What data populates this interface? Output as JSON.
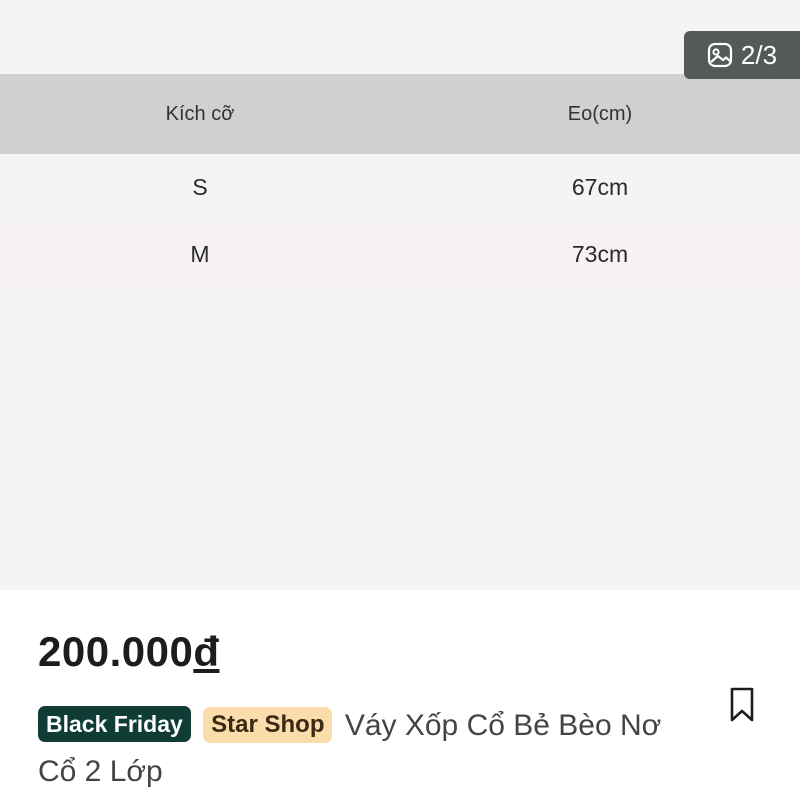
{
  "image_viewer": {
    "counter": "2/3",
    "counter_icon": "image-gallery-icon",
    "size_table": {
      "headers": [
        "Kích cỡ",
        "Eo(cm)"
      ],
      "rows": [
        [
          "S",
          "67cm"
        ],
        [
          "M",
          "73cm"
        ]
      ]
    }
  },
  "product": {
    "price": "200.000",
    "currency": "đ",
    "badges": {
      "campaign": "Black Friday",
      "shop": "Star Shop"
    },
    "title": "Váy Xốp Cổ Bẻ Bèo Nơ Cổ 2 Lớp",
    "bookmark_icon": "bookmark-icon"
  }
}
